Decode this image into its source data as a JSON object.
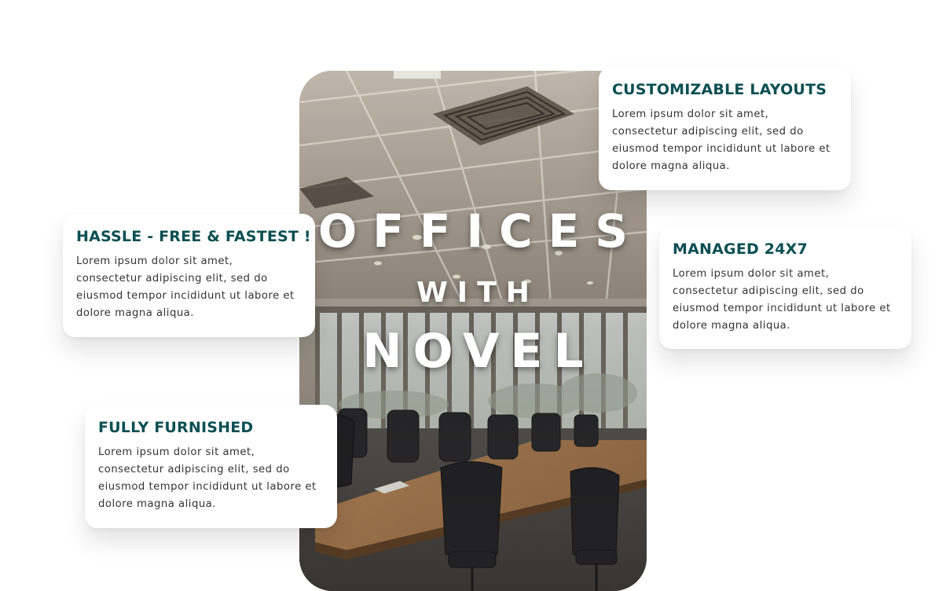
{
  "hero": {
    "line_1": "OFFICES",
    "line_2": "WITH",
    "line_3": "NOVEL"
  },
  "cards": [
    {
      "title": "CUSTOMIZABLE LAYOUTS",
      "body": "Lorem ipsum dolor sit amet, consectetur adipiscing elit, sed do eiusmod tempor incididunt ut labore et dolore magna aliqua."
    },
    {
      "title": "MANAGED 24X7",
      "body": "Lorem ipsum dolor sit amet, consectetur adipiscing elit, sed do eiusmod tempor incididunt ut labore et dolore magna aliqua."
    },
    {
      "title": "HASSLE - FREE & FASTEST !",
      "body": "Lorem ipsum dolor sit amet, consectetur adipiscing elit, sed do eiusmod tempor incididunt ut labore et dolore magna aliqua."
    },
    {
      "title": "FULLY FURNISHED",
      "body": "Lorem ipsum dolor sit amet, consectetur adipiscing elit, sed do eiusmod tempor incididunt ut labore et dolore magna aliqua."
    }
  ],
  "colors": {
    "title_teal": "#0b4f52",
    "body_text": "#333333",
    "card_bg": "#ffffff"
  }
}
